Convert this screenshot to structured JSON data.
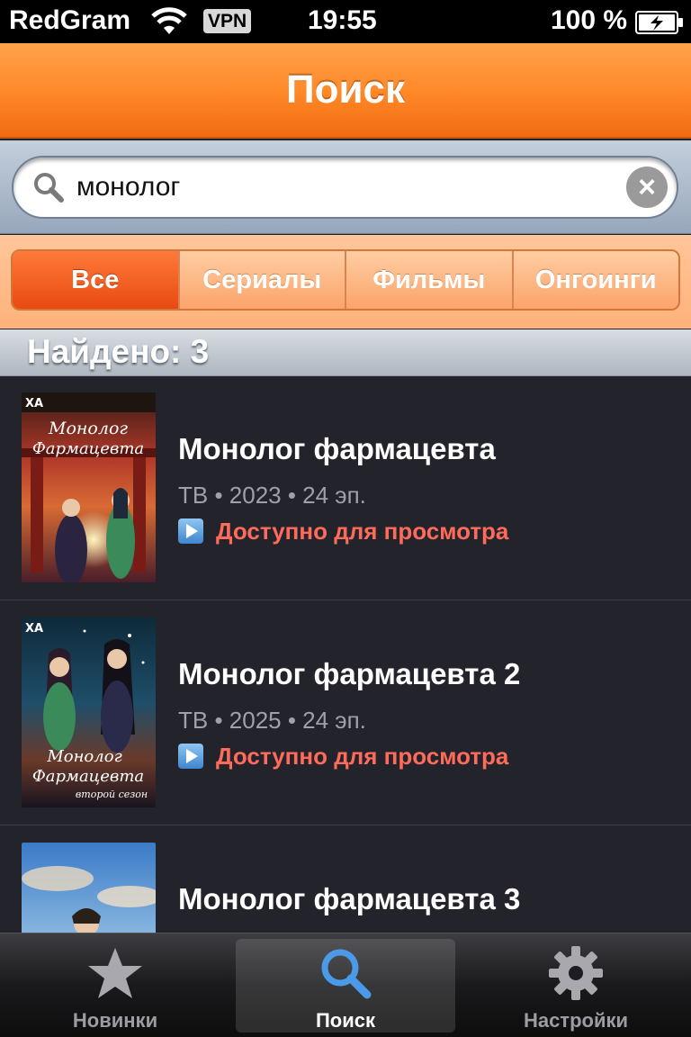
{
  "status_bar": {
    "carrier": "RedGram",
    "vpn": "VPN",
    "time": "19:55",
    "battery": "100 %"
  },
  "nav": {
    "title": "Поиск"
  },
  "search": {
    "value": "монолог"
  },
  "filters": {
    "items": [
      {
        "label": "Все",
        "active": true
      },
      {
        "label": "Сериалы",
        "active": false
      },
      {
        "label": "Фильмы",
        "active": false
      },
      {
        "label": "Онгоинги",
        "active": false
      }
    ]
  },
  "results": {
    "count_label": "Найдено: 3",
    "items": [
      {
        "title": "Монолог фармацевта",
        "meta": "ТВ • 2023 • 24 эп.",
        "status": "Доступно для просмотра",
        "poster_text": [
          "Монолог",
          "Фармацевта"
        ],
        "poster_badge": "XA"
      },
      {
        "title": "Монолог фармацевта 2",
        "meta": "ТВ • 2025 • 24 эп.",
        "status": "Доступно для просмотра",
        "poster_text": [
          "Монолог",
          "Фармацевта",
          "второй сезон"
        ],
        "poster_badge": "XA"
      },
      {
        "title": "Монолог фармацевта 3"
      }
    ]
  },
  "tabs": [
    {
      "label": "Новинки",
      "icon": "star-icon",
      "active": false
    },
    {
      "label": "Поиск",
      "icon": "search-icon",
      "active": true
    },
    {
      "label": "Настройки",
      "icon": "gear-icon",
      "active": false
    }
  ],
  "colors": {
    "accent": "#ff8a2a",
    "status_available": "#ff6b5a",
    "tab_active_icon": "#4a9ae8"
  }
}
